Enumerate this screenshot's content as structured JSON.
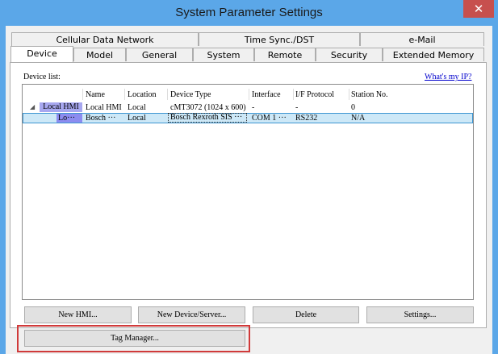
{
  "window": {
    "title": "System Parameter Settings",
    "close_glyph": "✕"
  },
  "tabs_row1": [
    {
      "label": "Cellular Data Network"
    },
    {
      "label": "Time Sync./DST"
    },
    {
      "label": "e-Mail"
    }
  ],
  "tabs_row2": [
    {
      "label": "Device",
      "active": true
    },
    {
      "label": "Model"
    },
    {
      "label": "General"
    },
    {
      "label": "System"
    },
    {
      "label": "Remote"
    },
    {
      "label": "Security"
    },
    {
      "label": "Extended Memory"
    }
  ],
  "device_list": {
    "label": "Device list:",
    "whats_my_ip": "What's my IP?",
    "columns": [
      "Name",
      "Location",
      "Device Type",
      "Interface",
      "I/F Protocol",
      "Station No."
    ],
    "rows": [
      {
        "tree": "Local HMI",
        "name": "Local HMI",
        "location": "Local",
        "device_type": "cMT3072 (1024 x 600)",
        "interface": "-",
        "protocol": "-",
        "station": "0"
      },
      {
        "tree": "Lo···",
        "name": "Bosch ···",
        "location": "Local",
        "device_type": "Bosch Rexroth SIS ···",
        "interface": "COM 1 ···",
        "protocol": "RS232",
        "station": "N/A"
      }
    ],
    "expand_glyph": "◢"
  },
  "buttons": {
    "new_hmi": "New HMI...",
    "new_device": "New Device/Server...",
    "delete": "Delete",
    "settings": "Settings...",
    "tag_manager": "Tag Manager..."
  },
  "colors": {
    "titlebar": "#5ba7e8",
    "close": "#c7504e",
    "selection": "#cde8f7",
    "tree_node": "#a7a7f0",
    "highlight": "#d03a3a"
  }
}
